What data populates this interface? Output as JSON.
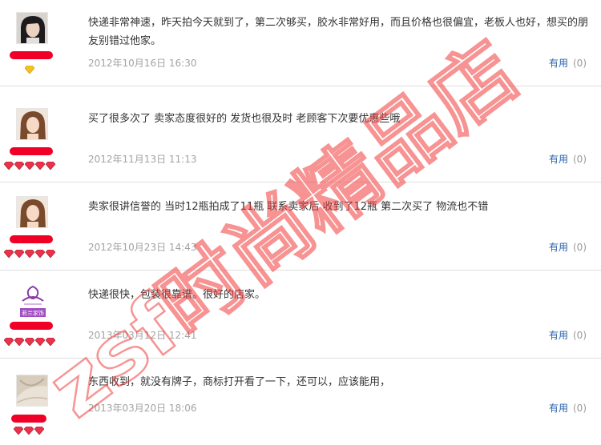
{
  "reviews": [
    {
      "text": "快递非常神速，昨天拍今天就到了，第二次够买，胶水非常好用，而且价格也很偏宜，老板人也好，想买的朋友别错过他家。",
      "date": "2012年10月16日 16:30",
      "helpful_label": "有用",
      "helpful_count": "(0)",
      "avatar_icon": "dark-hair-portrait-icon",
      "rank_icon": "gold-diamond-icon",
      "rank_count": 1,
      "rank_color": "#f5c21a"
    },
    {
      "text": "买了很多次了 卖家态度很好的 发货也很及时 老顾客下次要优惠些哦",
      "date": "2012年11月13日 11:13",
      "helpful_label": "有用",
      "helpful_count": "(0)",
      "avatar_icon": "woman-portrait-icon",
      "rank_icon": "red-diamond-icon",
      "rank_count": 5,
      "rank_color": "#e8334a"
    },
    {
      "text": "卖家很讲信誉的 当时12瓶拍成了11瓶 联系卖家后 收到了12瓶 第二次买了 物流也不错",
      "date": "2012年10月23日 14:43",
      "helpful_label": "有用",
      "helpful_count": "(0)",
      "avatar_icon": "woman-portrait-icon",
      "rank_icon": "red-diamond-icon",
      "rank_count": 5,
      "rank_color": "#e8334a"
    },
    {
      "text": "快递很快，包装很靠谱。很好的店家。",
      "date": "2013年03月12日 12:41",
      "helpful_label": "有用",
      "helpful_count": "(0)",
      "avatar_icon": "purple-logo-icon",
      "avatar_text": "若兰家饰",
      "rank_icon": "red-diamond-icon",
      "rank_count": 5,
      "rank_color": "#e8334a"
    },
    {
      "text": "东西收到，就没有牌子，商标打开看了一下，还可以，应该能用，",
      "date": "2013年03月20日 18:06",
      "helpful_label": "有用",
      "helpful_count": "(0)",
      "avatar_icon": "fabric-photo-icon",
      "rank_icon": "red-diamond-icon",
      "rank_count": 3,
      "rank_color": "#e8334a"
    }
  ],
  "watermark": {
    "text": "zsf时尚精品店",
    "color": "#f03a3a"
  }
}
